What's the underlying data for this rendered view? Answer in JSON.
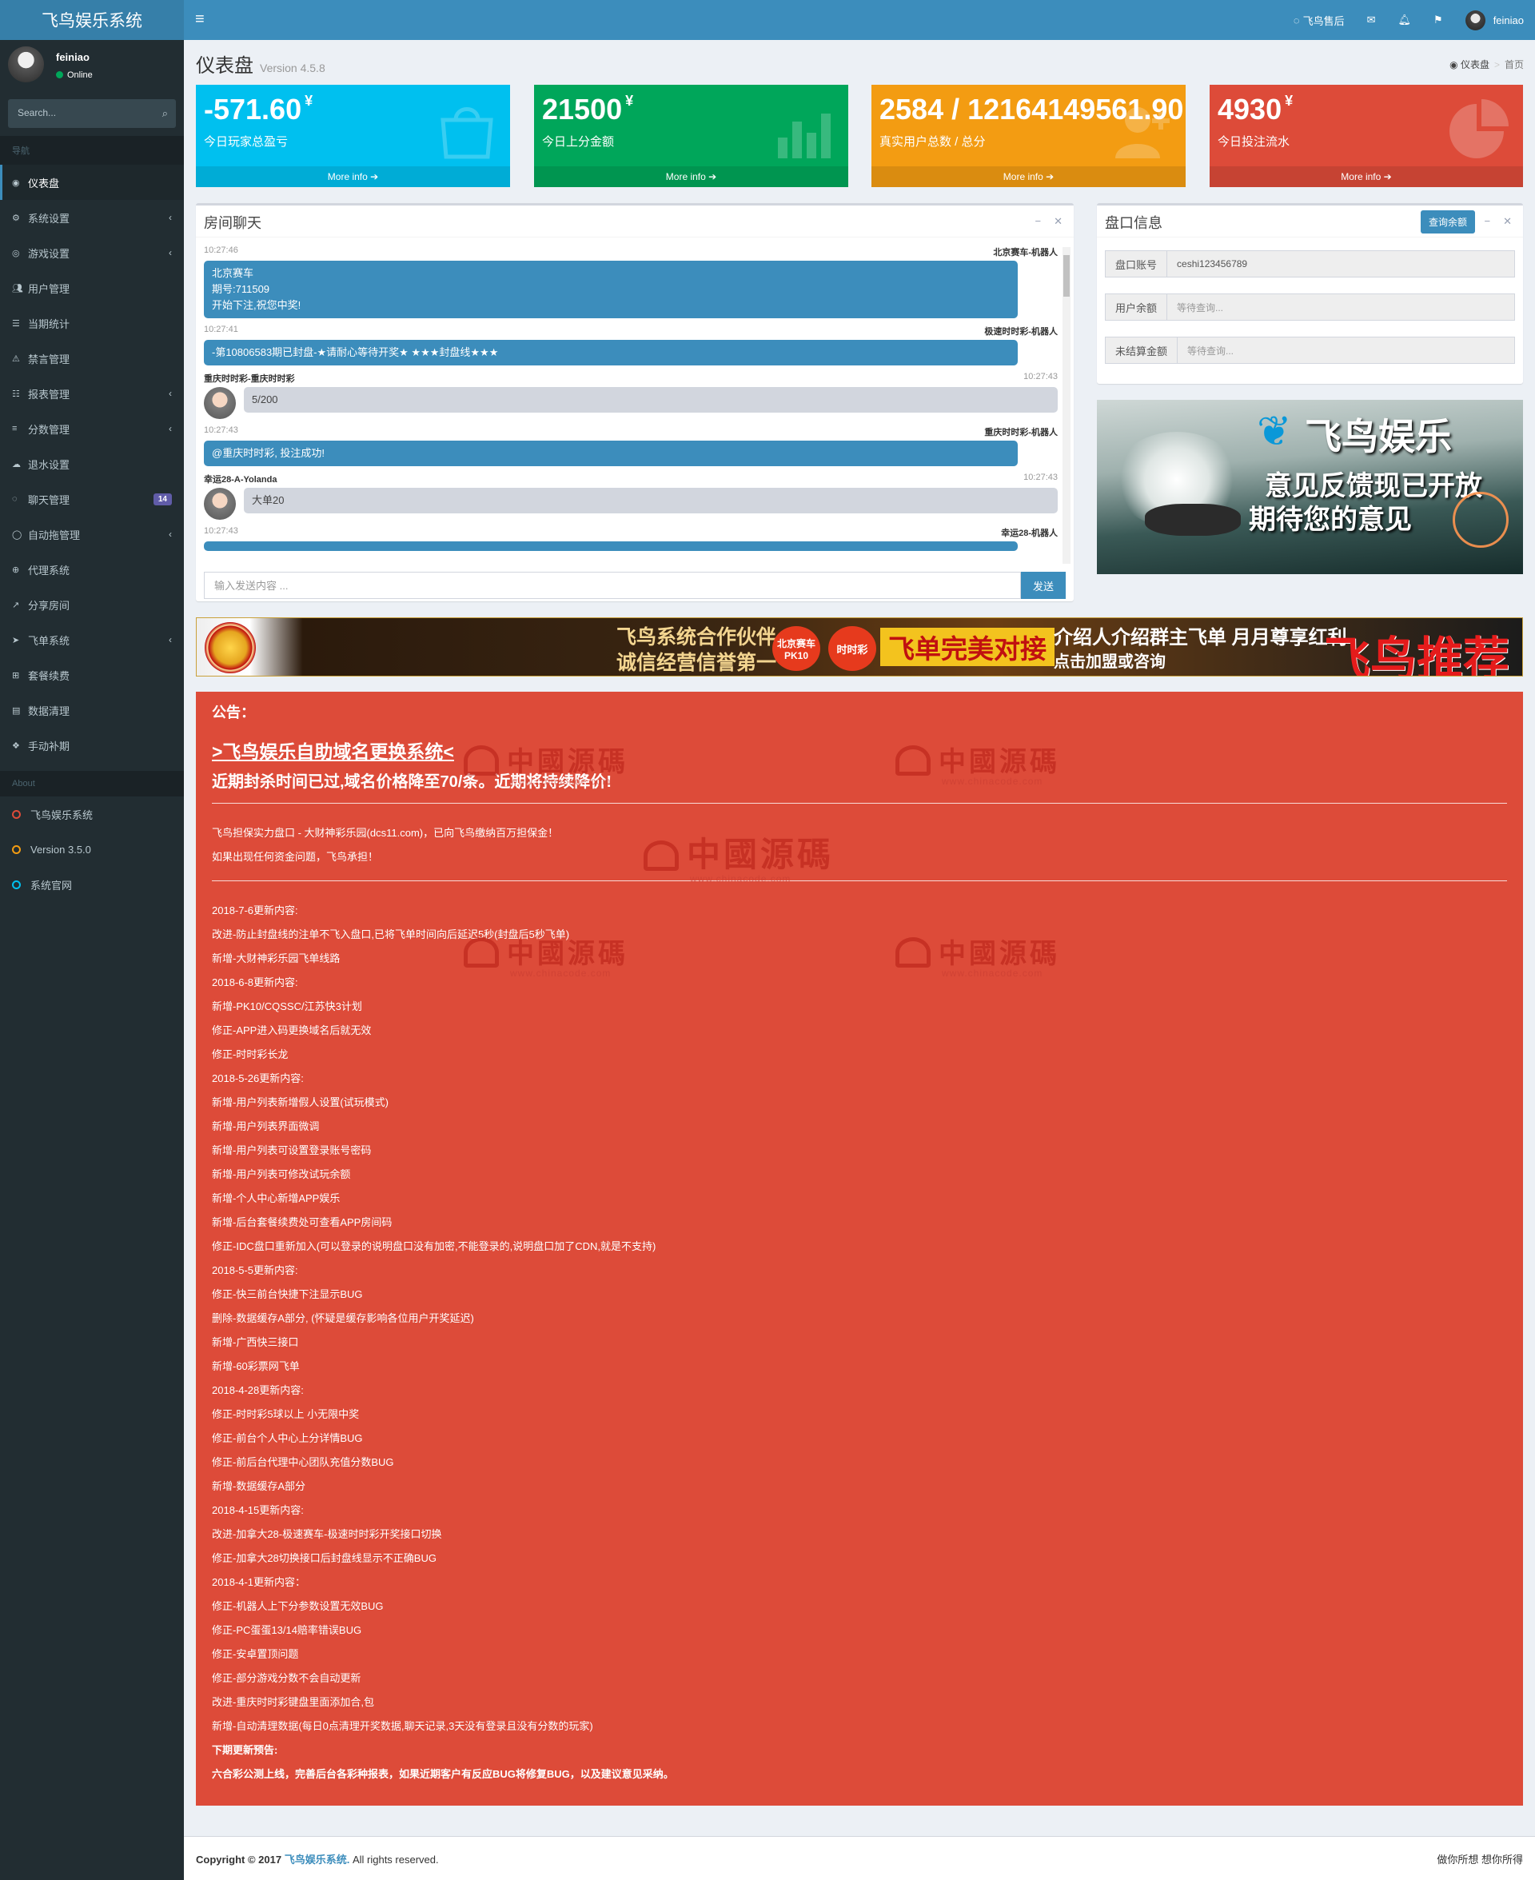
{
  "header": {
    "logo": "飞鸟娱乐系统",
    "toggle_icon": "≡",
    "support_label": "飞鸟售后",
    "username": "feiniao"
  },
  "sidebar": {
    "user": {
      "name": "feiniao",
      "status": "Online"
    },
    "search_placeholder": "Search...",
    "nav_header": "导航",
    "items": [
      {
        "label": "仪表盘",
        "icon": "dashboard-icon",
        "active": true,
        "chevron": false
      },
      {
        "label": "系统设置",
        "icon": "gears-icon",
        "chevron": true
      },
      {
        "label": "游戏设置",
        "icon": "gamepad-icon",
        "chevron": true
      },
      {
        "label": "用户管理",
        "icon": "users-icon",
        "chevron": false
      },
      {
        "label": "当期统计",
        "icon": "list-icon",
        "chevron": false
      },
      {
        "label": "禁言管理",
        "icon": "warning-icon",
        "chevron": false
      },
      {
        "label": "报表管理",
        "icon": "list-ol-icon",
        "chevron": true
      },
      {
        "label": "分数管理",
        "icon": "database-icon",
        "chevron": true
      },
      {
        "label": "退水设置",
        "icon": "cloud-icon",
        "chevron": false
      },
      {
        "label": "聊天管理",
        "icon": "comments-icon",
        "badge": "14"
      },
      {
        "label": "自动拖管理",
        "icon": "comment-icon",
        "chevron": true
      },
      {
        "label": "代理系统",
        "icon": "user-plus-icon",
        "chevron": false
      },
      {
        "label": "分享房间",
        "icon": "share-icon",
        "chevron": false
      },
      {
        "label": "飞单系统",
        "icon": "paper-plane-icon",
        "chevron": true
      },
      {
        "label": "套餐续费",
        "icon": "cart-icon",
        "chevron": false
      },
      {
        "label": "数据清理",
        "icon": "trash-icon",
        "chevron": false
      },
      {
        "label": "手动补期",
        "icon": "cubes-icon",
        "chevron": false
      }
    ],
    "about_header": "About",
    "about_items": [
      {
        "label": "飞鸟娱乐系统",
        "color": "#dd4b39"
      },
      {
        "label": "Version 3.5.0",
        "color": "#f39c12"
      },
      {
        "label": "系统官网",
        "color": "#00c0ef"
      }
    ]
  },
  "page": {
    "title": "仪表盘",
    "version": "Version 4.5.8",
    "breadcrumb": [
      "仪表盘",
      "首页"
    ]
  },
  "stats": [
    {
      "value": "-571.60",
      "unit": "¥",
      "label": "今日玩家总盈亏",
      "more": "More info",
      "color": "#00c0ef",
      "icon": "shopping-bag-icon"
    },
    {
      "value": "21500",
      "unit": "¥",
      "label": "今日上分金额",
      "more": "More info",
      "color": "#00a65a",
      "icon": "bar-chart-icon"
    },
    {
      "value": "2584 / 12164149561.90",
      "unit": "¥",
      "label": "真实用户总数 / 总分",
      "more": "More info",
      "color": "#f39c12",
      "icon": "user-add-icon"
    },
    {
      "value": "4930",
      "unit": "¥",
      "label": "今日投注流水",
      "more": "More info",
      "color": "#dd4b39",
      "icon": "pie-chart-icon"
    }
  ],
  "chat": {
    "title": "房间聊天",
    "input_placeholder": "输入发送内容 ...",
    "send_label": "发送",
    "messages": [
      {
        "time": "10:27:46",
        "name": "北京赛车-机器人",
        "side": "right",
        "text": [
          "北京赛车",
          "期号:711509",
          "开始下注,祝您中奖!"
        ]
      },
      {
        "time": "10:27:41",
        "name": "极速时时彩-机器人",
        "side": "right",
        "text": [
          "-第10806583期已封盘-★请耐心等待开奖★ ★★★封盘线★★★"
        ]
      },
      {
        "time": "10:27:43",
        "name": "重庆时时彩-重庆时时彩",
        "side": "left",
        "text": [
          "5/200"
        ]
      },
      {
        "time": "10:27:43",
        "name": "重庆时时彩-机器人",
        "side": "right",
        "text": [
          "@重庆时时彩, 投注成功!"
        ]
      },
      {
        "time": "10:27:43",
        "name": "幸运28-A-Yolanda",
        "side": "left",
        "text": [
          "大单20"
        ]
      },
      {
        "time": "10:27:43",
        "name": "幸运28-机器人",
        "side": "right",
        "text": [
          ""
        ]
      }
    ]
  },
  "pankou": {
    "title": "盘口信息",
    "query_button": "查询余额",
    "fields": [
      {
        "label": "盘口账号",
        "value": "ceshi123456789",
        "placeholder": false
      },
      {
        "label": "用户余额",
        "value": "等待查询...",
        "placeholder": true
      },
      {
        "label": "未结算金额",
        "value": "等待查询...",
        "placeholder": true
      }
    ]
  },
  "feedback_banner": {
    "brand": "飞鸟娱乐",
    "line1": "意见反馈现已开放",
    "line2": "期待您的意见"
  },
  "partner_banner": {
    "t1": "飞鸟系统合作伙伴",
    "t2": "诚信经营信誉第一",
    "b1": "北京赛车 PK10",
    "b2": "时时彩",
    "t3": "飞单完美对接",
    "t4": "介绍人介绍群主飞单 月月尊享红利",
    "t5": "点击加盟或咨询",
    "t6": "飞鸟推荐"
  },
  "notice": {
    "title": "公告：",
    "link": ">飞鸟娱乐自助域名更换系统<",
    "subtitle": "近期封杀时间已过,域名价格降至70/条。近期将持续降价!",
    "guarantee": [
      "飞鸟担保实力盘口 - 大财神彩乐园(dcs11.com)，已向飞鸟缴纳百万担保金！",
      "如果出现任何资金问题，飞鸟承担！"
    ],
    "changelog": [
      {
        "t": "2018-7-6更新内容:"
      },
      {
        "t": "改进-防止封盘线的注单不飞入盘口,已将飞单时间向后延迟5秒(封盘后5秒飞单)"
      },
      {
        "t": "新增-大财神彩乐园飞单线路"
      },
      {
        "t": "2018-6-8更新内容:"
      },
      {
        "t": "新增-PK10/CQSSC/江苏快3计划"
      },
      {
        "t": "修正-APP进入码更换域名后就无效"
      },
      {
        "t": "修正-时时彩长龙"
      },
      {
        "t": "2018-5-26更新内容:"
      },
      {
        "t": "新增-用户列表新增假人设置(试玩模式)"
      },
      {
        "t": "新增-用户列表界面微调"
      },
      {
        "t": "新增-用户列表可设置登录账号密码"
      },
      {
        "t": "新增-用户列表可修改试玩余额"
      },
      {
        "t": "新增-个人中心新增APP娱乐"
      },
      {
        "t": "新增-后台套餐续费处可查看APP房间码"
      },
      {
        "t": "修正-IDC盘口重新加入(可以登录的说明盘口没有加密,不能登录的,说明盘口加了CDN,就是不支持)"
      },
      {
        "t": "2018-5-5更新内容:"
      },
      {
        "t": "修正-快三前台快捷下注显示BUG"
      },
      {
        "t": "删除-数据缓存A部分, (怀疑是缓存影响各位用户开奖延迟)"
      },
      {
        "t": "新增-广西快三接口"
      },
      {
        "t": "新增-60彩票网飞单"
      },
      {
        "t": "2018-4-28更新内容:"
      },
      {
        "t": "修正-时时彩5球以上 小无限中奖"
      },
      {
        "t": "修正-前台个人中心上分详情BUG"
      },
      {
        "t": "修正-前后台代理中心团队充值分数BUG"
      },
      {
        "t": "新增-数据缓存A部分"
      },
      {
        "t": "2018-4-15更新内容:"
      },
      {
        "t": "改进-加拿大28-极速赛车-极速时时彩开奖接口切换"
      },
      {
        "t": "修正-加拿大28切换接口后封盘线显示不正确BUG"
      },
      {
        "t": "2018-4-1更新内容："
      },
      {
        "t": "修正-机器人上下分参数设置无效BUG"
      },
      {
        "t": "修正-PC蛋蛋13/14赔率错误BUG"
      },
      {
        "t": "修正-安卓置顶问题"
      },
      {
        "t": "修正-部分游戏分数不会自动更新"
      },
      {
        "t": "改进-重庆时时彩键盘里面添加合,包"
      },
      {
        "t": "新增-自动清理数据(每日0点清理开奖数据,聊天记录,3天没有登录且没有分数的玩家)"
      },
      {
        "t": "下期更新预告:",
        "b": true
      },
      {
        "t": "六合彩公测上线，完善后台各彩种报表，如果近期客户有反应BUG将修复BUG，以及建议意见采纳。",
        "b": true
      }
    ]
  },
  "watermark": {
    "text": "中國源碼",
    "url": "www.chinacode.com"
  },
  "footer": {
    "copyright_prefix": "Copyright © 2017 ",
    "brand": "飞鸟娱乐系统.",
    "suffix": " All rights reserved.",
    "right": "做你所想 想你所得"
  }
}
